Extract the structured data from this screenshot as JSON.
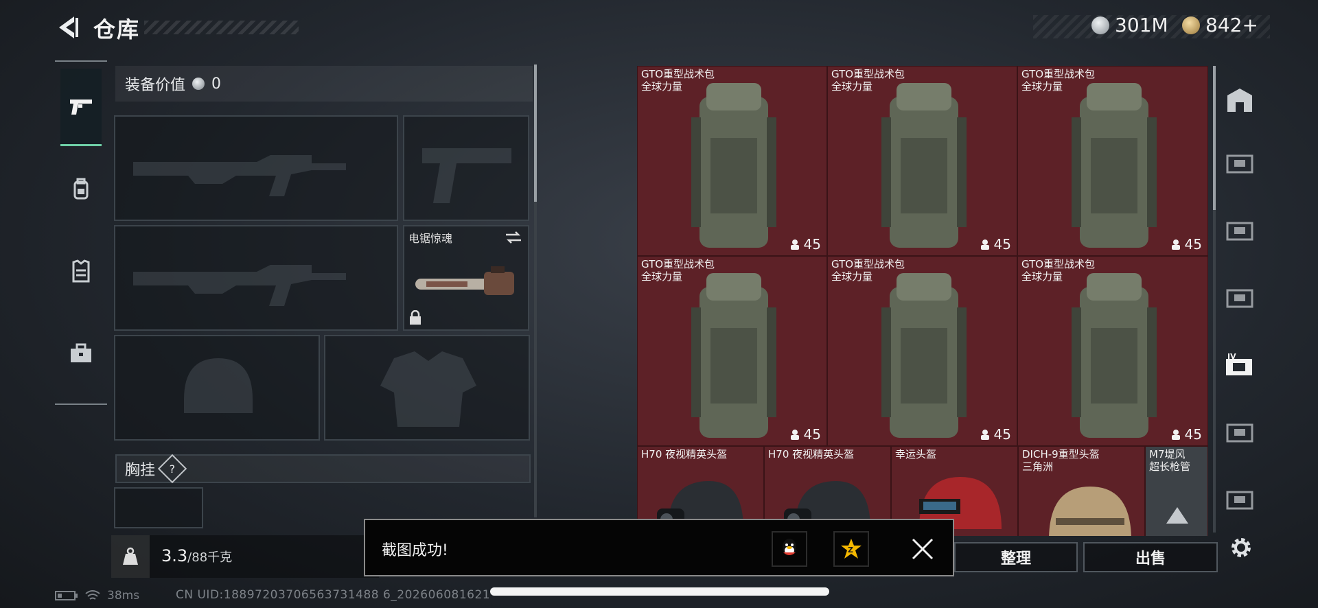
{
  "header": {
    "title": "仓库"
  },
  "currency": {
    "primary": {
      "value": "301M",
      "icon": "silver-coin-icon",
      "color": "#b9bfc4"
    },
    "secondary": {
      "value": "842+",
      "icon": "gold-coin-icon",
      "color": "#c9a564"
    }
  },
  "left_tabs": [
    {
      "icon": "pistol-icon",
      "active": true
    },
    {
      "icon": "backpack-icon",
      "active": false
    },
    {
      "icon": "vest-icon",
      "active": false
    },
    {
      "icon": "toolbox-icon",
      "active": false
    }
  ],
  "loadout": {
    "equip_value_label": "装备价值",
    "equip_value": "0",
    "melee_label": "电锯惊魂",
    "chest_rig_label": "胸挂",
    "chest_rig_help": "?"
  },
  "weight": {
    "current": "3.3",
    "capacity": "/88千克"
  },
  "stash": {
    "backpack_name": "GTO重型战术包",
    "backpack_tag": "全球力量",
    "backpack_qty": "45",
    "cells": [
      {
        "name": "GTO重型战术包",
        "tag": "全球力量",
        "qty": "45"
      },
      {
        "name": "GTO重型战术包",
        "tag": "全球力量",
        "qty": "45"
      },
      {
        "name": "GTO重型战术包",
        "tag": "全球力量",
        "qty": "45"
      },
      {
        "name": "GTO重型战术包",
        "tag": "全球力量",
        "qty": "45"
      },
      {
        "name": "GTO重型战术包",
        "tag": "全球力量",
        "qty": "45"
      },
      {
        "name": "GTO重型战术包",
        "tag": "全球力量",
        "qty": "45"
      }
    ],
    "helmets": [
      {
        "name": "H70 夜视精英头盔",
        "tag": ""
      },
      {
        "name": "H70 夜视精英头盔",
        "tag": ""
      },
      {
        "name": "幸运头盔",
        "tag": ""
      },
      {
        "name": "DICH-9重型头盔",
        "tag": "三角洲"
      },
      {
        "name": "M7堤风",
        "tag": "超长枪管"
      }
    ]
  },
  "right_rail": [
    "vault-icon",
    "case-icon",
    "case-icon",
    "case-icon",
    "case-iv-icon",
    "case-icon",
    "case-icon"
  ],
  "buttons": {
    "sort": "整理",
    "sell": "出售"
  },
  "toast": {
    "message": "截图成功!",
    "share1": "qq-icon",
    "share2": "qzone-icon"
  },
  "status": {
    "ping": "38ms",
    "uid": "CN UID:18897203706563731488 6_202606081621"
  }
}
